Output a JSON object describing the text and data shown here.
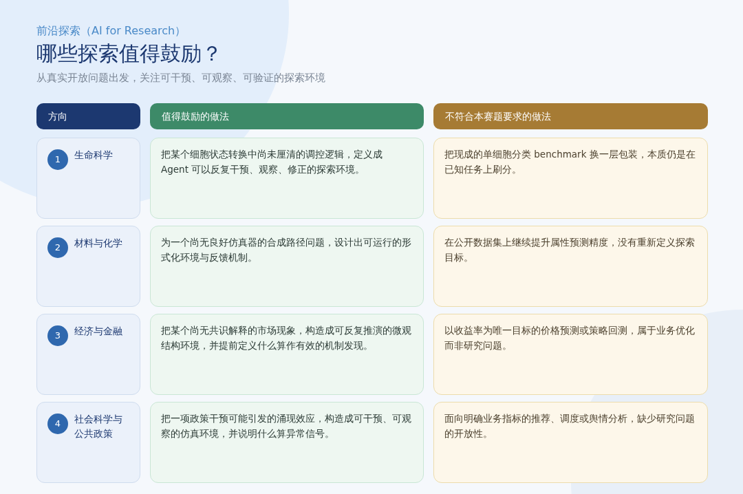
{
  "eyebrow": "前沿探索（AI for Research）",
  "title": "哪些探索值得鼓励？",
  "subtitle": "从真实开放问题出发，关注可干预、可观察、可验证的探索环境",
  "columns": [
    {
      "label": "方向",
      "color": "#1c3870"
    },
    {
      "label": "值得鼓励的做法",
      "color": "#3d8a68"
    },
    {
      "label": "不符合本赛题要求的做法",
      "color": "#a67b34"
    }
  ],
  "rows": [
    {
      "number": "1",
      "direction": "生命科学",
      "encouraged": "把某个细胞状态转换中尚未厘清的调控逻辑，定义成 Agent 可以反复干预、观察、修正的探索环境。",
      "not_accepted": "把现成的单细胞分类 benchmark 换一层包装，本质仍是在已知任务上刷分。"
    },
    {
      "number": "2",
      "direction": "材料与化学",
      "encouraged": "为一个尚无良好仿真器的合成路径问题，设计出可运行的形式化环境与反馈机制。",
      "not_accepted": "在公开数据集上继续提升属性预测精度，没有重新定义探索目标。"
    },
    {
      "number": "3",
      "direction": "经济与金融",
      "encouraged": "把某个尚无共识解释的市场现象，构造成可反复推演的微观结构环境，并提前定义什么算作有效的机制发现。",
      "not_accepted": "以收益率为唯一目标的价格预测或策略回测，属于业务优化而非研究问题。"
    },
    {
      "number": "4",
      "direction": "社会科学与公共政策",
      "encouraged": "把一项政策干预可能引发的涌现效应，构造成可干预、可观察的仿真环境，并说明什么算异常信号。",
      "not_accepted": "面向明确业务指标的推荐、调度或舆情分析，缺少研究问题的开放性。"
    }
  ]
}
